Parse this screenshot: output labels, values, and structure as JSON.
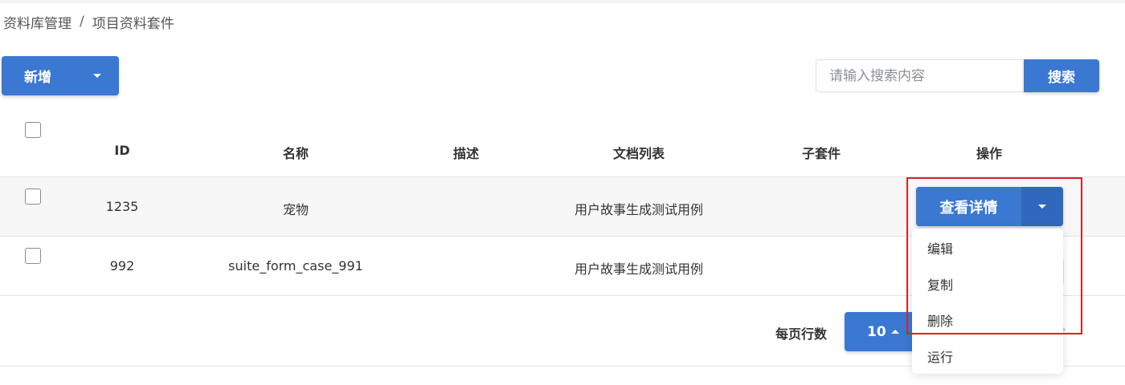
{
  "breadcrumb": {
    "items": [
      "资料库管理",
      "项目资料套件"
    ],
    "separator": "/"
  },
  "toolbar": {
    "add_label": "新增"
  },
  "search": {
    "placeholder": "请输入搜索内容",
    "button_label": "搜索"
  },
  "table": {
    "columns": [
      "ID",
      "名称",
      "描述",
      "文档列表",
      "子套件",
      "操作"
    ],
    "rows": [
      {
        "id": "1235",
        "name": "宠物",
        "desc": "",
        "docs": "用户故事生成测试用例",
        "sub": ""
      },
      {
        "id": "992",
        "name": "suite_form_case_991",
        "desc": "",
        "docs": "用户故事生成测试用例",
        "sub": ""
      }
    ]
  },
  "actions": {
    "detail_label": "查看详情",
    "menu": [
      "编辑",
      "复制",
      "删除",
      "运行"
    ]
  },
  "pagination": {
    "rows_per_page_label": "每页行数",
    "page_size": "10",
    "next_icon": "chevron-right-icon"
  },
  "colors": {
    "primary": "#3a78d2",
    "highlight": "#e02020"
  }
}
